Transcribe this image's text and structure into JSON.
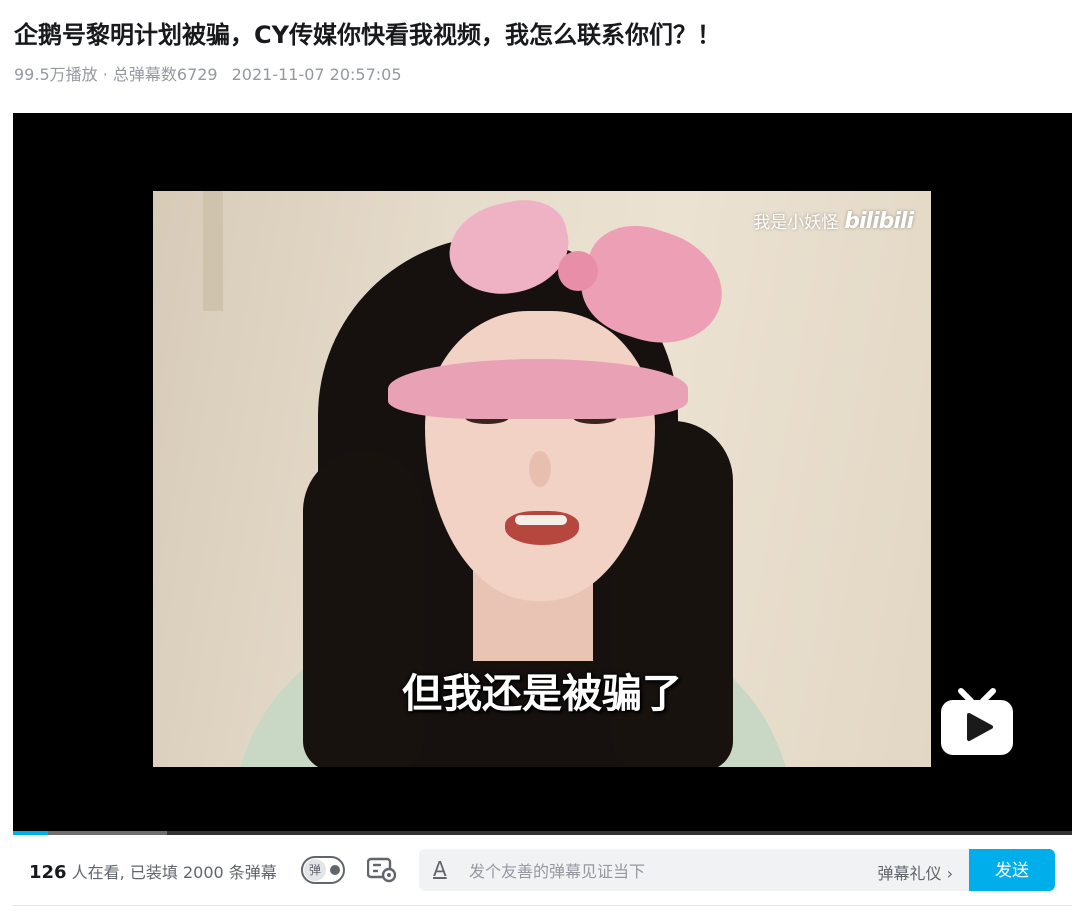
{
  "video": {
    "title": "企鹅号黎明计划被骗，CY传媒你快看我视频，我怎么联系你们？！",
    "stats": "99.5万播放 · 总弹幕数6729",
    "date": "2021-11-07 20:57:05"
  },
  "player": {
    "watermark_text": "我是小妖怪",
    "watermark_logo": "bilibili",
    "subtitle": "但我还是被骗了",
    "progress_played_fraction": 0.033,
    "progress_buffer_fraction": 0.145
  },
  "danmaku_bar": {
    "viewers_count": "126",
    "viewers_text": "人在看, 已装填",
    "loaded_count": "2000",
    "loaded_suffix": "条弹幕",
    "toggle_label": "弹",
    "input_placeholder": "发个友善的弹幕见证当下",
    "etiquette_label": "弹幕礼仪 ›",
    "send_label": "发送"
  },
  "colors": {
    "accent": "#00aeec",
    "title_text": "#18191c",
    "meta_text": "#9499a0"
  }
}
